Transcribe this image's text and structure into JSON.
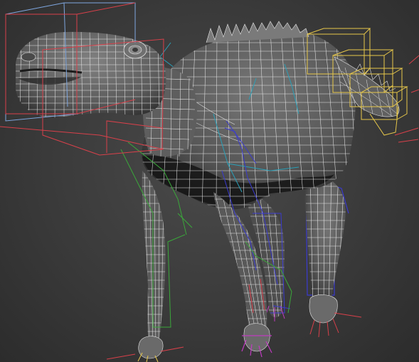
{
  "viewport": {
    "colors": {
      "background": "#3b3b3b",
      "mesh_fill": "#5c5c5c",
      "mesh_shadow": "#1a1a1a",
      "wire": "#e6e6e6",
      "rig_head": "#d9404a",
      "rig_head_outer": "#7fa7e0",
      "rig_tail": "#e8c84a",
      "rig_spine": "#29a0b8",
      "rig_left_leg": "#3aa83a",
      "rig_right_leg": "#3a3ad0",
      "rig_foot": "#c03ac0"
    }
  }
}
